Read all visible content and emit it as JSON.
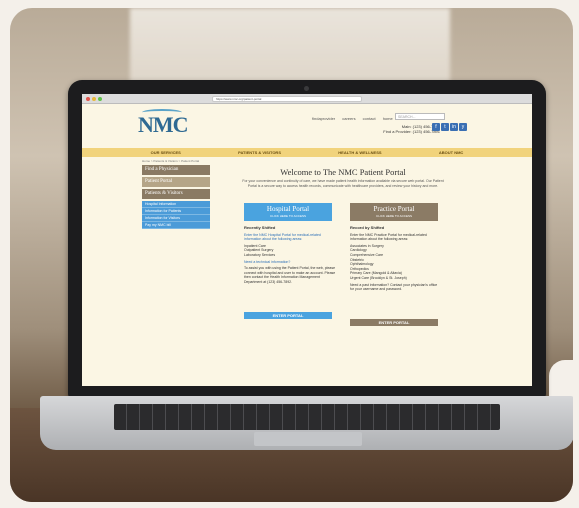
{
  "browser": {
    "url": "https://www.nmc.org/patient-portal"
  },
  "header": {
    "logo": "NMC",
    "top_links": "findaprovider careers contact home",
    "search_placeholder": "SEARCH...",
    "phone_line1": "Main: (123) 456-7890",
    "phone_line2": "Find a Provider: (123) 456-7891",
    "social": [
      "f",
      "t",
      "in",
      "y"
    ]
  },
  "nav": {
    "items": [
      "OUR SERVICES",
      "PATIENTS & VISITORS",
      "HEALTH & WELLNESS",
      "ABOUT NMC"
    ]
  },
  "breadcrumb": "Home > Patients & Visitors > Patient Portal",
  "sidebar": {
    "items": [
      {
        "label": "Find a Physician",
        "style": "brown"
      },
      {
        "label": "Patient Portal",
        "style": "tan"
      },
      {
        "label": "Patients & Visitors",
        "style": "brown"
      }
    ],
    "subitems": [
      "Hospital Information",
      "Information for Patients",
      "Information for Visitors",
      "Pay my NMC bill"
    ]
  },
  "main": {
    "title": "Welcome to The NMC Patient Portal",
    "intro": "For your convenience and continuity of care, we have made patient health information available via secure web portal. Our Patient Portal is a secure way to access health records, communicate with healthcare providers, and review your history and more.",
    "hospital": {
      "title": "Hospital Portal",
      "subtitle": "CLICK HERE TO ACCESS",
      "section_head": "Recently Shifted",
      "link": "Enter the NMC Hospital Portal for medical-related information about the following areas:",
      "items": [
        "Inpatient Care",
        "Outpatient Surgery",
        "Laboratory Services"
      ],
      "help_link": "Need a technical information?",
      "help_text": "To assist you with using the Patient Portal, the web, please connect with hospital and user to make an account. Please then contact the Health Information Management Department at (123) 456-7892.",
      "button": "ENTER PORTAL"
    },
    "practice": {
      "title": "Practice Portal",
      "subtitle": "CLICK HERE TO ACCESS",
      "section_head": "Record by Shifted",
      "link": "Enter the NMC Practice Portal for medical-related information about the following areas:",
      "items": [
        "Associates in Surgery",
        "Cardiology",
        "Comprehensive Care",
        "Obstetric",
        "Ophthalmology",
        "Orthopedics",
        "Primary Care (Mangold & Altavia)",
        "Urgent Care (Brooklyn & St. Joseph)"
      ],
      "help_text": "Need a past information? Contact your physician's office for your username and password.",
      "button": "ENTER PORTAL"
    }
  }
}
